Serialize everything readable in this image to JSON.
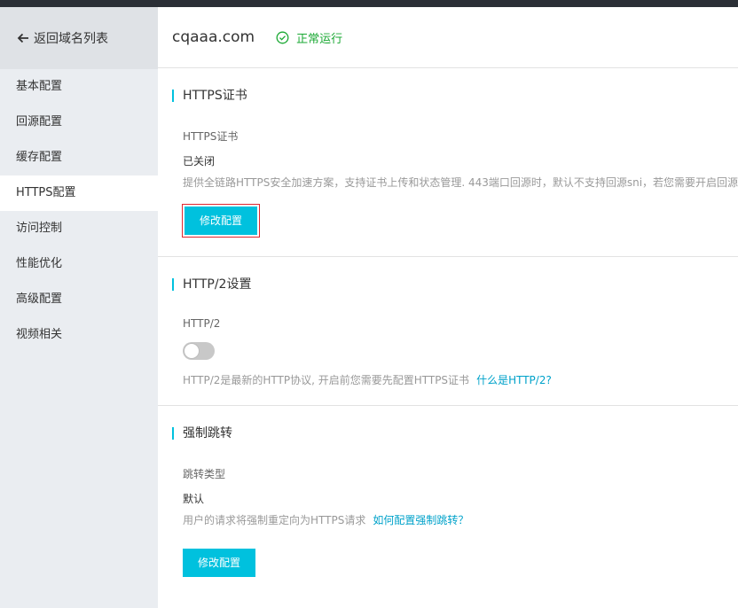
{
  "sidebar": {
    "back_label": "返回域名列表",
    "items": [
      {
        "label": "基本配置"
      },
      {
        "label": "回源配置"
      },
      {
        "label": "缓存配置"
      },
      {
        "label": "HTTPS配置"
      },
      {
        "label": "访问控制"
      },
      {
        "label": "性能优化"
      },
      {
        "label": "高级配置"
      },
      {
        "label": "视频相关"
      }
    ],
    "active_index": 3
  },
  "header": {
    "domain": "cqaaa.com",
    "status": "正常运行",
    "status_color": "#1aa833"
  },
  "https_section": {
    "title": "HTTPS证书",
    "field_label": "HTTPS证书",
    "value": "已关闭",
    "description": "提供全链路HTTPS安全加速方案，支持证书上传和状态管理. 443端口回源时，默认不支持回源sni，若您需要开启回源sni",
    "button_label": "修改配置"
  },
  "http2_section": {
    "title": "HTTP/2设置",
    "field_label": "HTTP/2",
    "toggle_on": false,
    "description": "HTTP/2是最新的HTTP协议, 开启前您需要先配置HTTPS证书",
    "link_label": "什么是HTTP/2?"
  },
  "redirect_section": {
    "title": "强制跳转",
    "field_label": "跳转类型",
    "value": "默认",
    "description": "用户的请求将强制重定向为HTTPS请求",
    "link_label": "如何配置强制跳转？",
    "button_label": "修改配置"
  },
  "colors": {
    "accent": "#00c1de",
    "link": "#00a2ca",
    "highlight_border": "#e0262e"
  }
}
